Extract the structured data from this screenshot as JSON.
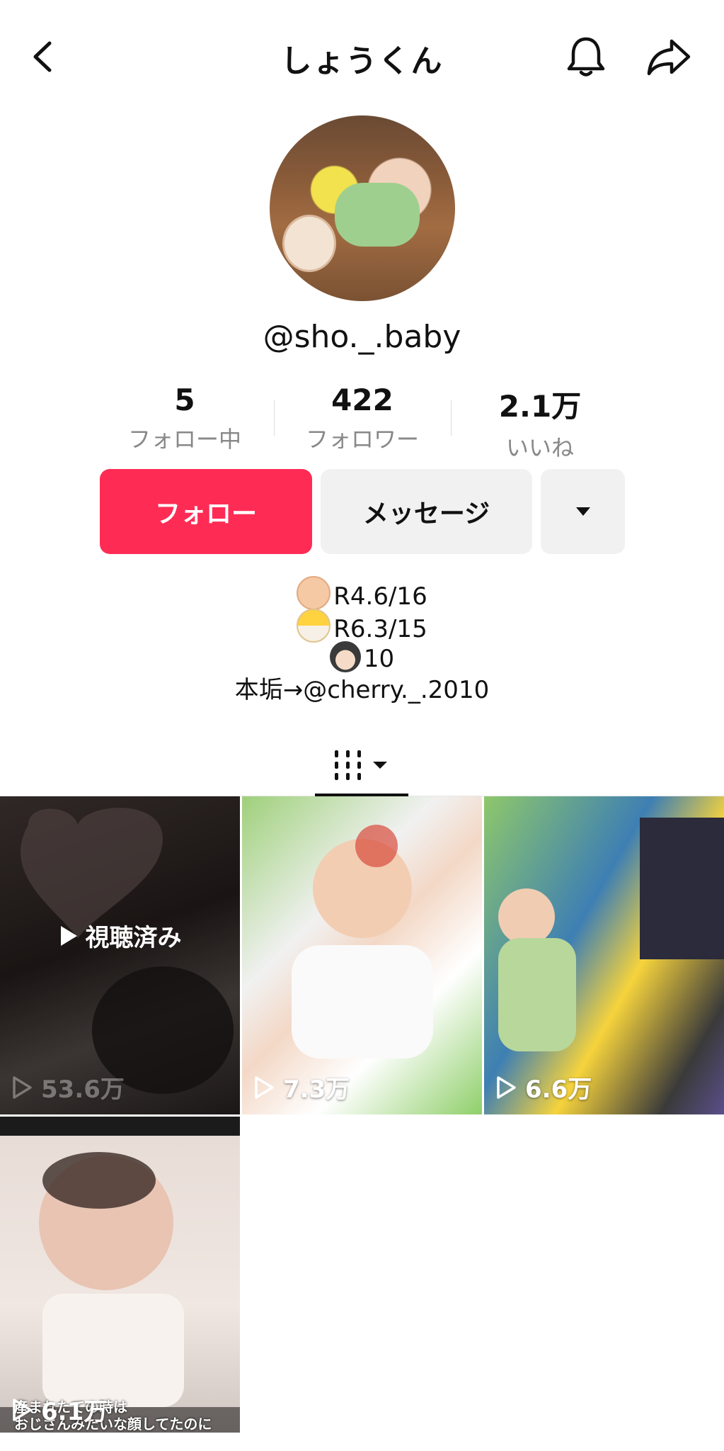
{
  "header": {
    "title": "しょうくん"
  },
  "profile": {
    "handle": "@sho._.baby",
    "stats": [
      {
        "value": "5",
        "label": "フォロー中"
      },
      {
        "value": "422",
        "label": "フォロワー"
      },
      {
        "value": "2.1万",
        "label": "いいね"
      }
    ]
  },
  "actions": {
    "follow_label": "フォロー",
    "message_label": "メッセージ"
  },
  "bio": {
    "lines": [
      "R4.6/16",
      "R6.3/15",
      "10",
      "本垢→@cherry._.2010"
    ]
  },
  "videos": [
    {
      "views": "53.6万",
      "overlay": "視聴済み"
    },
    {
      "views": "7.3万"
    },
    {
      "views": "6.6万"
    },
    {
      "views": "6.1万",
      "caption_line1": "産まれたての時は",
      "caption_line2": "おじさんみたいな顔してたのに"
    }
  ],
  "colors": {
    "accent": "#fe2c55",
    "secondary_button": "#f1f1f2"
  }
}
